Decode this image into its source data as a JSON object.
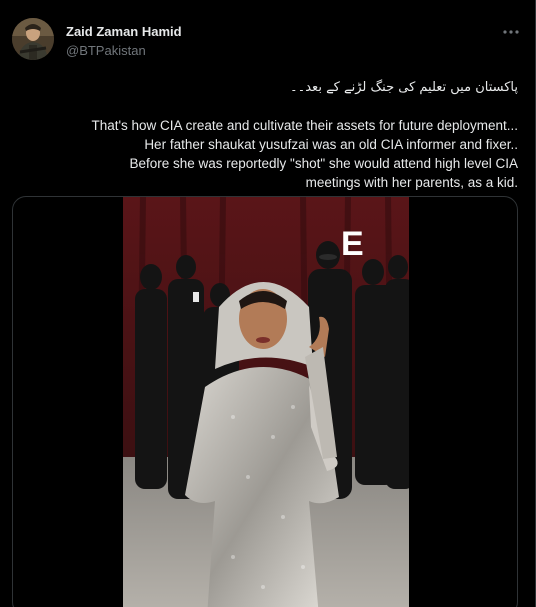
{
  "author": {
    "display_name": "Zaid Zaman Hamid",
    "handle": "@BTPakistan"
  },
  "icons": {
    "more": "more-options-icon",
    "avatar": "profile-photo"
  },
  "tweet": {
    "urdu_line": "پاکستان میں تعلیم کی جنگ لڑنے کے بعد۔۔",
    "lines": [
      "That's how CIA create and cultivate their assets for future deployment...",
      "Her father shaukat yusufzai was an old CIA informer and fixer..",
      "Before she was reportedly \"shot\" she would attend high level CIA",
      "meetings with her parents, as a kid."
    ]
  },
  "media": {
    "watermark": "E"
  },
  "colors": {
    "background": "#000000",
    "text": "#e7e9ea",
    "secondary_text": "#71767b",
    "border": "#2f3336"
  }
}
